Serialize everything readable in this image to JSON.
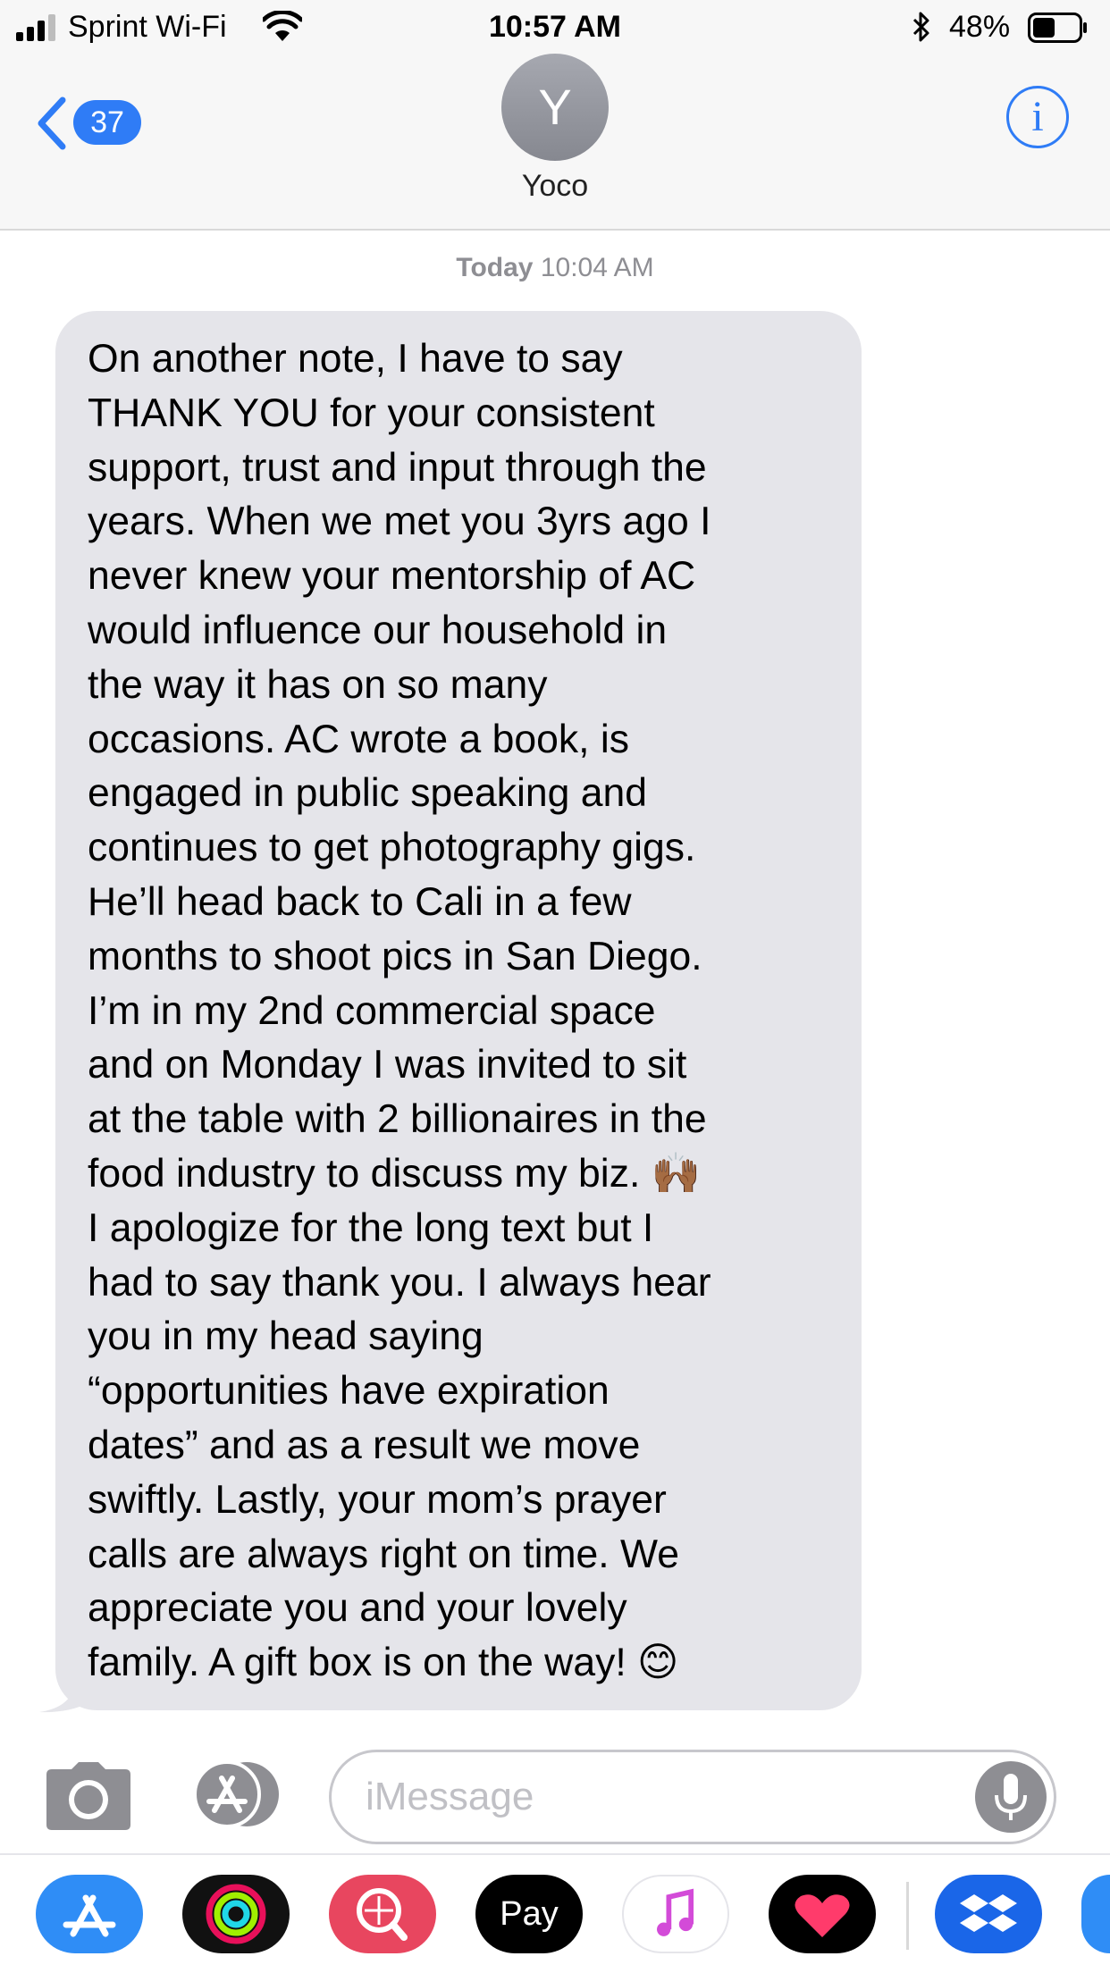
{
  "status_bar": {
    "carrier": "Sprint Wi-Fi",
    "time": "10:57 AM",
    "battery_percent": "48%",
    "battery_level": 0.48,
    "signal_bars": 3
  },
  "nav": {
    "back_badge": "37",
    "avatar_initial": "Y",
    "contact_name": "Yoco",
    "info_glyph": "i"
  },
  "conversation": {
    "timestamp_day": "Today",
    "timestamp_time": "10:04 AM",
    "message": "On another note, I have to say\nTHANK YOU for your consistent\nsupport, trust and input through the\nyears. When we met you 3yrs ago I\nnever knew your mentorship of AC\nwould influence our household in\nthe way it has on so many\noccasions. AC wrote a book, is\nengaged in public speaking and\ncontinues to get photography gigs.\nHe’ll head back to Cali in a few\nmonths to shoot pics in San Diego.\nI’m in my 2nd commercial space\nand on Monday I was invited to sit\nat the table with 2 billionaires in the\nfood industry to discuss my biz. 🙌🏾\nI apologize for the long text but I\nhad to say thank you. I always hear\nyou in my head saying\n“opportunities have expiration\ndates” and as a result we move\nswiftly. Lastly, your mom’s prayer\ncalls are always right on time. We\nappreciate you and your lovely\nfamily. A gift box is on the way! 😊"
  },
  "input": {
    "placeholder": "iMessage",
    "value": ""
  },
  "drawer": {
    "apps": [
      {
        "name": "App Store",
        "icon": "app-store-icon",
        "color": "#2f8df6"
      },
      {
        "name": "Activity",
        "icon": "activity-icon",
        "color": "#111111"
      },
      {
        "name": "Search",
        "icon": "web-search-icon",
        "color": "#e8465f"
      },
      {
        "name": "Pay",
        "icon": "apple-pay-icon",
        "color": "#000000",
        "label": "Pay"
      },
      {
        "name": "Music",
        "icon": "music-icon",
        "color": "#ffffff"
      },
      {
        "name": "Digital Touch",
        "icon": "digital-touch-icon",
        "color": "#000000"
      },
      {
        "name": "Dropbox",
        "icon": "dropbox-icon",
        "color": "#1a66e8"
      }
    ]
  },
  "colors": {
    "accent": "#2f7cf6",
    "bubble_gray": "#e5e5ea",
    "bar_gray": "#f7f7f7",
    "secondary_text": "#8e8e93"
  }
}
